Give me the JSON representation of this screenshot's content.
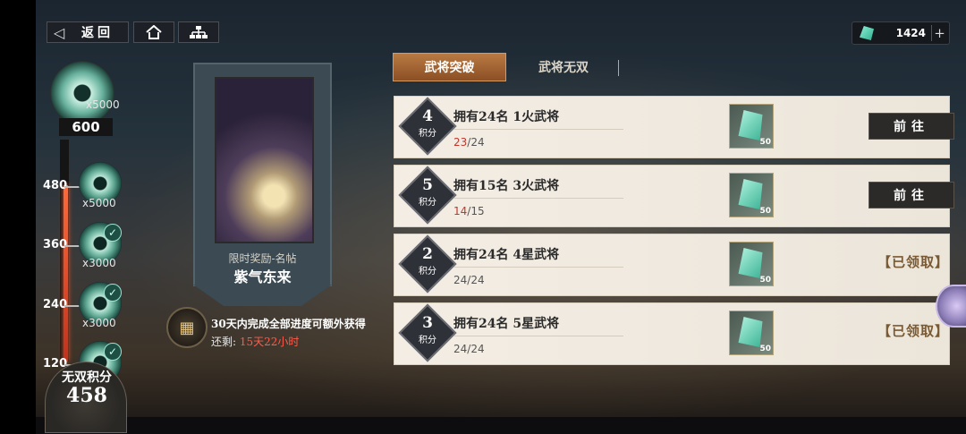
{
  "header": {
    "back_label": "返回",
    "back_icon": "chevron-left-icon",
    "home_icon": "home-icon",
    "tree_icon": "hierarchy-icon"
  },
  "currency": {
    "icon": "jade-gem-icon",
    "amount": "1424",
    "add_label": "+"
  },
  "progress": {
    "top_reward": {
      "qty": "x5000",
      "points": "600"
    },
    "milestones": [
      "480",
      "360",
      "240",
      "120"
    ],
    "rewards": [
      {
        "qty": "x5000",
        "claimed": false
      },
      {
        "qty": "x3000",
        "claimed": true
      },
      {
        "qty": "x3000",
        "claimed": true
      },
      {
        "qty": "",
        "claimed": true
      }
    ],
    "fill_fraction": 0.76,
    "score_label": "无双积分",
    "score_value": "458"
  },
  "card": {
    "tag": "限时奖励-名帖",
    "name": "紫气东来"
  },
  "bonus": {
    "text": "30天内完成全部进度可额外获得",
    "remain_label": "还剩:",
    "remain_value": "15天22小时"
  },
  "tabs": [
    {
      "label": "武将突破",
      "active": true
    },
    {
      "label": "武将无双",
      "active": false
    }
  ],
  "tasks": [
    {
      "points": "4",
      "points_label": "积分",
      "title": "拥有24名 1火武将",
      "current": "23",
      "total": "/24",
      "incomplete": true,
      "reward_qty": "50",
      "action": "前往",
      "claimed": false
    },
    {
      "points": "5",
      "points_label": "积分",
      "title": "拥有15名 3火武将",
      "current": "14",
      "total": "/15",
      "incomplete": true,
      "reward_qty": "50",
      "action": "前往",
      "claimed": false
    },
    {
      "points": "2",
      "points_label": "积分",
      "title": "拥有24名 4星武将",
      "current": "24",
      "total": "/24",
      "incomplete": false,
      "reward_qty": "50",
      "action": "【已领取】",
      "claimed": true
    },
    {
      "points": "3",
      "points_label": "积分",
      "title": "拥有24名 5星武将",
      "current": "24",
      "total": "/24",
      "incomplete": false,
      "reward_qty": "50",
      "action": "【已领取】",
      "claimed": true
    }
  ],
  "colors": {
    "accent_tab": "#b97a43",
    "progress_fill": "#ff6a3a",
    "alert_red": "#c0372c"
  }
}
